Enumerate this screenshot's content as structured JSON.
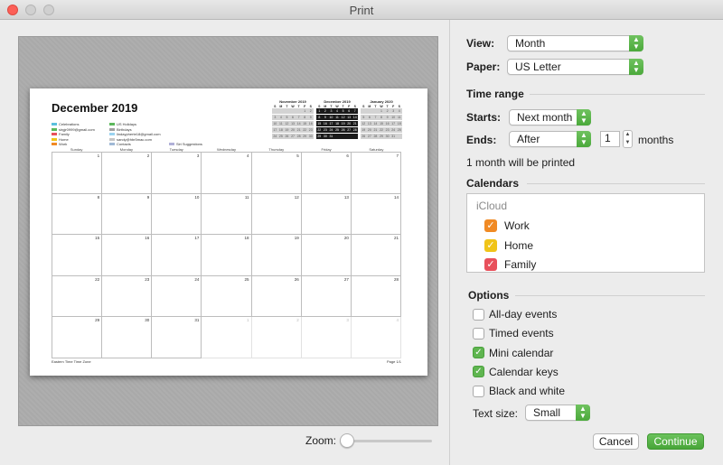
{
  "window": {
    "title": "Print"
  },
  "preview": {
    "month_title": "December 2019",
    "legend_col1": [
      {
        "label": "Celebrations",
        "color": "#5bc0de"
      },
      {
        "label": "sirgjr0999@gmail.com",
        "color": "#5cb85c"
      },
      {
        "label": "Family",
        "color": "#e8505b"
      },
      {
        "label": "Home",
        "color": "#f0c419"
      },
      {
        "label": "Work",
        "color": "#f08a24"
      }
    ],
    "legend_col2": [
      {
        "label": "US Holidays",
        "color": "#5cb85c"
      },
      {
        "label": "Birthdays",
        "color": "#a0a0a0"
      },
      {
        "label": "lindaypherte18@gmail.com",
        "color": "#9ad3f0"
      },
      {
        "label": "sandy@hbr5mac.com",
        "color": "#c5c5c5"
      },
      {
        "label": "Contacts",
        "color": "#9fb9d6"
      }
    ],
    "legend_col3": [
      {
        "label": "Siri Suggestions",
        "color": "#b0b0d8"
      }
    ],
    "minicals": [
      {
        "title": "November 2019",
        "weeks": [
          [
            "",
            "",
            "",
            "",
            "",
            "1",
            "2"
          ],
          [
            "3",
            "4",
            "5",
            "6",
            "7",
            "8",
            "9"
          ],
          [
            "10",
            "11",
            "12",
            "13",
            "14",
            "15",
            "16"
          ],
          [
            "17",
            "18",
            "19",
            "20",
            "21",
            "22",
            "23"
          ],
          [
            "24",
            "25",
            "26",
            "27",
            "28",
            "29",
            "30"
          ]
        ]
      },
      {
        "title": "December 2019",
        "weeks": [
          [
            "1",
            "2",
            "3",
            "4",
            "5",
            "6",
            "7"
          ],
          [
            "8",
            "9",
            "10",
            "11",
            "12",
            "13",
            "14"
          ],
          [
            "15",
            "16",
            "17",
            "18",
            "19",
            "20",
            "21"
          ],
          [
            "22",
            "23",
            "24",
            "25",
            "26",
            "27",
            "28"
          ],
          [
            "29",
            "30",
            "31",
            "",
            "",
            "",
            ""
          ]
        ]
      },
      {
        "title": "January 2020",
        "weeks": [
          [
            "",
            "",
            "",
            "1",
            "2",
            "3",
            "4"
          ],
          [
            "5",
            "6",
            "7",
            "8",
            "9",
            "10",
            "11"
          ],
          [
            "12",
            "13",
            "14",
            "15",
            "16",
            "17",
            "18"
          ],
          [
            "19",
            "20",
            "21",
            "22",
            "23",
            "24",
            "25"
          ],
          [
            "26",
            "27",
            "28",
            "29",
            "30",
            "31",
            ""
          ]
        ]
      }
    ],
    "weekday_initials": [
      "S",
      "M",
      "T",
      "W",
      "T",
      "F",
      "S"
    ],
    "weekdays": [
      "Sunday",
      "Monday",
      "Tuesday",
      "Wednesday",
      "Thursday",
      "Friday",
      "Saturday"
    ],
    "weeks": [
      [
        "1",
        "2",
        "3",
        "4",
        "5",
        "6",
        "7"
      ],
      [
        "8",
        "9",
        "10",
        "11",
        "12",
        "13",
        "14"
      ],
      [
        "15",
        "16",
        "17",
        "18",
        "19",
        "20",
        "21"
      ],
      [
        "22",
        "23",
        "24",
        "25",
        "26",
        "27",
        "28"
      ],
      [
        "29",
        "30",
        "31",
        "1",
        "2",
        "3",
        "4"
      ]
    ],
    "footer_left": "Eastern Time Time Zone",
    "footer_right": "Page 1/1"
  },
  "zoom": {
    "label": "Zoom:"
  },
  "panel": {
    "view_label": "View:",
    "view_value": "Month",
    "paper_label": "Paper:",
    "paper_value": "US Letter",
    "time_range_heading": "Time range",
    "starts_label": "Starts:",
    "starts_value": "Next month",
    "ends_label": "Ends:",
    "ends_value": "After",
    "ends_count": "1",
    "ends_unit": "months",
    "summary": "1 month will be printed",
    "calendars_heading": "Calendars",
    "calendar_source": "iCloud",
    "calendars": [
      {
        "label": "Work",
        "color": "#f08a24",
        "checked": true
      },
      {
        "label": "Home",
        "color": "#f0c419",
        "checked": true
      },
      {
        "label": "Family",
        "color": "#e8505b",
        "checked": true
      }
    ],
    "options_heading": "Options",
    "options": [
      {
        "label": "All-day events",
        "checked": false
      },
      {
        "label": "Timed events",
        "checked": false
      },
      {
        "label": "Mini calendar",
        "checked": true
      },
      {
        "label": "Calendar keys",
        "checked": true
      },
      {
        "label": "Black and white",
        "checked": false
      }
    ],
    "text_size_label": "Text size:",
    "text_size_value": "Small",
    "cancel_label": "Cancel",
    "continue_label": "Continue"
  }
}
